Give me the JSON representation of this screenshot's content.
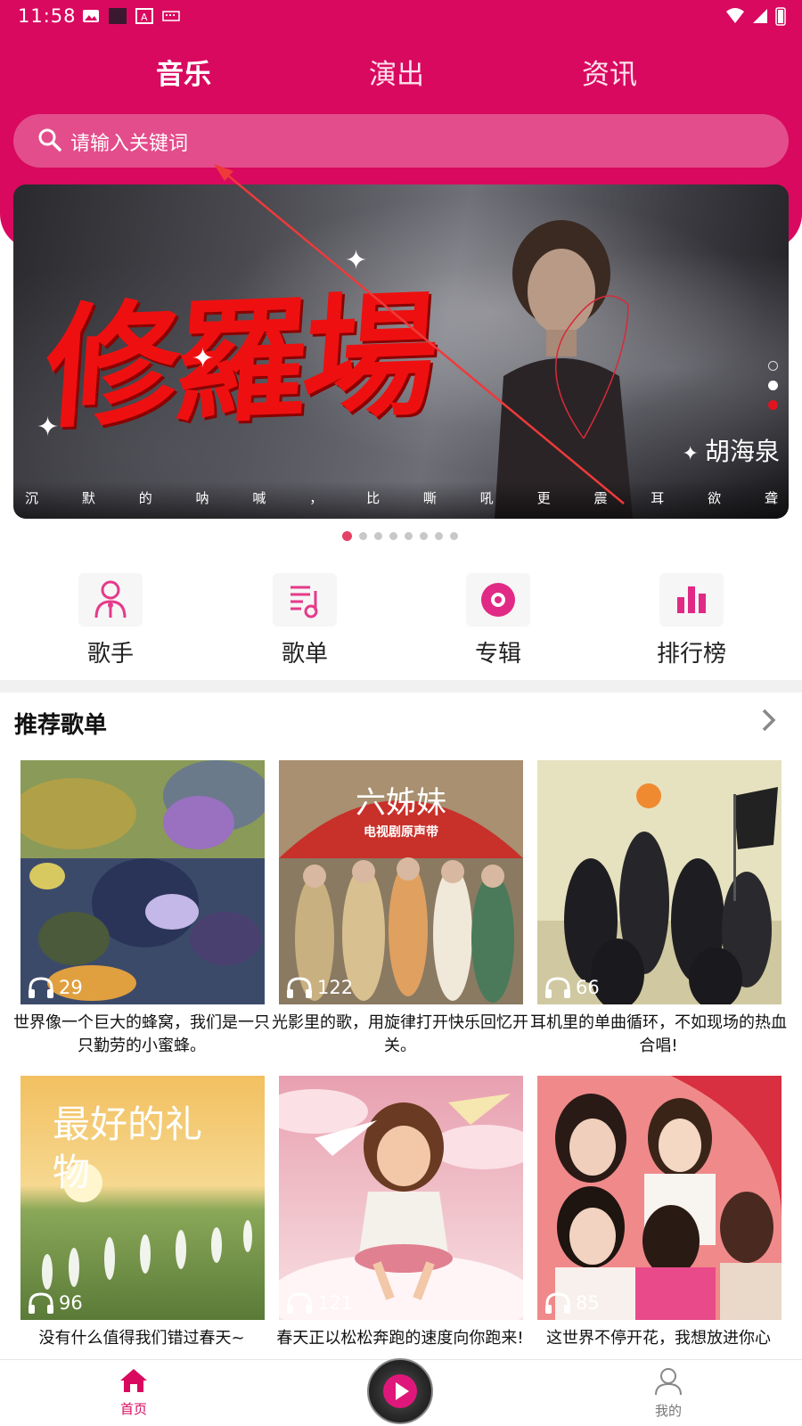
{
  "status": {
    "time": "11:58"
  },
  "tabs": [
    {
      "label": "音乐",
      "active": true
    },
    {
      "label": "演出",
      "active": false
    },
    {
      "label": "资讯",
      "active": false
    }
  ],
  "search": {
    "placeholder": "请输入关键词"
  },
  "banner": {
    "title": "修羅場",
    "artist": "胡海泉",
    "caption": [
      "沉",
      "默",
      "的",
      "呐",
      "喊",
      "，",
      "比",
      "嘶",
      "吼",
      "更",
      "震",
      "耳",
      "欲",
      "聋"
    ],
    "page_count": 8,
    "active_page": 1
  },
  "categories": [
    {
      "label": "歌手",
      "icon": "singer-icon"
    },
    {
      "label": "歌单",
      "icon": "playlist-icon"
    },
    {
      "label": "专辑",
      "icon": "album-icon"
    },
    {
      "label": "排行榜",
      "icon": "chart-icon"
    }
  ],
  "recommend": {
    "title": "推荐歌单",
    "playlists": [
      {
        "count": "29",
        "title": "世界像一个巨大的蜂窝，我们是一只只勤劳的小蜜蜂。"
      },
      {
        "count": "122",
        "title": "光影里的歌，用旋律打开快乐回忆开关。"
      },
      {
        "count": "66",
        "title": "耳机里的单曲循环，不如现场的热血合唱!"
      },
      {
        "count": "96",
        "title": "没有什么值得我们错过春天~"
      },
      {
        "count": "121",
        "title": "春天正以松松奔跑的速度向你跑来!"
      },
      {
        "count": "85",
        "title": "这世界不停开花，我想放进你心"
      }
    ],
    "cover_texts": {
      "second_title": "六姊妹",
      "second_subtitle": "电视剧原声带",
      "fourth_title": "最好的礼物"
    }
  },
  "bottom_nav": {
    "home": "首页",
    "mine": "我的"
  },
  "colors": {
    "brand": "#d9095f",
    "accent": "#e54065"
  }
}
